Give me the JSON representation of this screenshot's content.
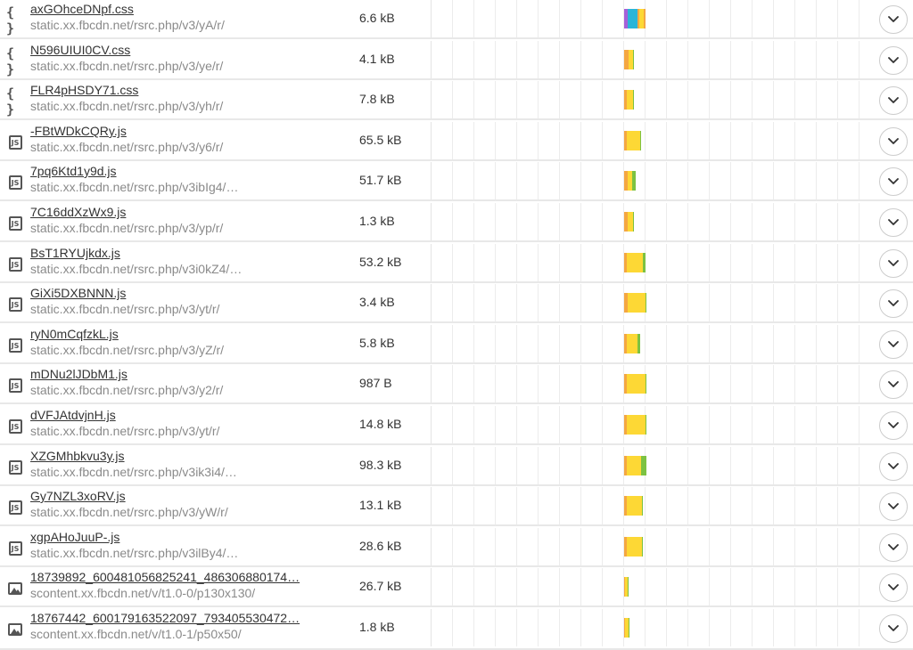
{
  "colors": {
    "blocking": "#f4a742",
    "connect": "#2bb5d8",
    "tls": "#a560d8",
    "waiting": "#fdd835",
    "receiving": "#7cc242",
    "expand_border": "#cccccc"
  },
  "requests": [
    {
      "type": "css",
      "icon": "css-braces-icon",
      "name": "axGOhceDNpf.css",
      "url": "static.xx.fbcdn.net/rsrc.php/v3/yA/r/",
      "size": "6.6 kB",
      "timing": [
        {
          "phase": "tls",
          "start": 0.6838,
          "width": 0.0039
        },
        {
          "phase": "connect",
          "start": 0.6877,
          "width": 0.0107
        },
        {
          "phase": "blocking",
          "start": 0.6984,
          "width": 0.002
        },
        {
          "phase": "waiting",
          "start": 0.7004,
          "width": 0.0049
        },
        {
          "phase": "blocking",
          "start": 0.7053,
          "width": 0.002
        }
      ]
    },
    {
      "type": "css",
      "icon": "css-braces-icon",
      "name": "N596UIUI0CV.css",
      "url": "static.xx.fbcdn.net/rsrc.php/v3/ye/r/",
      "size": "4.1 kB",
      "timing": [
        {
          "phase": "blocking",
          "start": 0.6838,
          "width": 0.0049
        },
        {
          "phase": "waiting",
          "start": 0.6887,
          "width": 0.0049
        },
        {
          "phase": "receiving",
          "start": 0.6936,
          "width": 0.001
        }
      ]
    },
    {
      "type": "css",
      "icon": "css-braces-icon",
      "name": "FLR4pHSDY71.css",
      "url": "static.xx.fbcdn.net/rsrc.php/v3/yh/r/",
      "size": "7.8 kB",
      "timing": [
        {
          "phase": "blocking",
          "start": 0.6838,
          "width": 0.0029
        },
        {
          "phase": "waiting",
          "start": 0.6867,
          "width": 0.0068
        },
        {
          "phase": "receiving",
          "start": 0.6935,
          "width": 0.001
        }
      ]
    },
    {
      "type": "js",
      "icon": "js-file-icon",
      "name": "-FBtWDkCQRy.js",
      "url": "static.xx.fbcdn.net/rsrc.php/v3/y6/r/",
      "size": "65.5 kB",
      "timing": [
        {
          "phase": "blocking",
          "start": 0.6838,
          "width": 0.0029
        },
        {
          "phase": "waiting",
          "start": 0.6867,
          "width": 0.0146
        },
        {
          "phase": "receiving",
          "start": 0.7013,
          "width": 0.001
        }
      ]
    },
    {
      "type": "js",
      "icon": "js-file-icon",
      "name": "7pq6Ktd1y9d.js",
      "url": "static.xx.fbcdn.net/rsrc.php/v3ibIg4/…",
      "size": "51.7 kB",
      "timing": [
        {
          "phase": "blocking",
          "start": 0.6838,
          "width": 0.0039
        },
        {
          "phase": "waiting",
          "start": 0.6877,
          "width": 0.0049
        },
        {
          "phase": "receiving",
          "start": 0.6926,
          "width": 0.0039
        }
      ]
    },
    {
      "type": "js",
      "icon": "js-file-icon",
      "name": "7C16ddXzWx9.js",
      "url": "static.xx.fbcdn.net/rsrc.php/v3/yp/r/",
      "size": "1.3 kB",
      "timing": [
        {
          "phase": "blocking",
          "start": 0.6838,
          "width": 0.0039
        },
        {
          "phase": "waiting",
          "start": 0.6877,
          "width": 0.0059
        },
        {
          "phase": "receiving",
          "start": 0.6936,
          "width": 0.001
        }
      ]
    },
    {
      "type": "js",
      "icon": "js-file-icon",
      "name": "BsT1RYUjkdx.js",
      "url": "static.xx.fbcdn.net/rsrc.php/v3i0kZ4/…",
      "size": "53.2 kB",
      "timing": [
        {
          "phase": "blocking",
          "start": 0.6838,
          "width": 0.0029
        },
        {
          "phase": "waiting",
          "start": 0.6867,
          "width": 0.0176
        },
        {
          "phase": "receiving",
          "start": 0.7043,
          "width": 0.0029
        }
      ]
    },
    {
      "type": "js",
      "icon": "js-file-icon",
      "name": "GiXi5DXBNNN.js",
      "url": "static.xx.fbcdn.net/rsrc.php/v3/yt/r/",
      "size": "3.4 kB",
      "timing": [
        {
          "phase": "blocking",
          "start": 0.6838,
          "width": 0.0039
        },
        {
          "phase": "waiting",
          "start": 0.6877,
          "width": 0.0195
        },
        {
          "phase": "receiving",
          "start": 0.7072,
          "width": 0.001
        }
      ]
    },
    {
      "type": "js",
      "icon": "js-file-icon",
      "name": "ryN0mCqfzkL.js",
      "url": "static.xx.fbcdn.net/rsrc.php/v3/yZ/r/",
      "size": "5.8 kB",
      "timing": [
        {
          "phase": "blocking",
          "start": 0.6838,
          "width": 0.0029
        },
        {
          "phase": "waiting",
          "start": 0.6867,
          "width": 0.0117
        },
        {
          "phase": "receiving",
          "start": 0.6984,
          "width": 0.0029
        }
      ]
    },
    {
      "type": "js",
      "icon": "js-file-icon",
      "name": "mDNu2lJDbM1.js",
      "url": "static.xx.fbcdn.net/rsrc.php/v3/y2/r/",
      "size": "987 B",
      "timing": [
        {
          "phase": "blocking",
          "start": 0.6838,
          "width": 0.0029
        },
        {
          "phase": "waiting",
          "start": 0.6867,
          "width": 0.0205
        },
        {
          "phase": "receiving",
          "start": 0.7072,
          "width": 0.001
        }
      ]
    },
    {
      "type": "js",
      "icon": "js-file-icon",
      "name": "dVFJAtdvjnH.js",
      "url": "static.xx.fbcdn.net/rsrc.php/v3/yt/r/",
      "size": "14.8 kB",
      "timing": [
        {
          "phase": "blocking",
          "start": 0.6838,
          "width": 0.0029
        },
        {
          "phase": "waiting",
          "start": 0.6867,
          "width": 0.0205
        },
        {
          "phase": "receiving",
          "start": 0.7072,
          "width": 0.001
        }
      ]
    },
    {
      "type": "js",
      "icon": "js-file-icon",
      "name": "XZGMhbkvu3y.js",
      "url": "static.xx.fbcdn.net/rsrc.php/v3ik3i4/…",
      "size": "98.3 kB",
      "timing": [
        {
          "phase": "blocking",
          "start": 0.6838,
          "width": 0.0029
        },
        {
          "phase": "waiting",
          "start": 0.6867,
          "width": 0.0156
        },
        {
          "phase": "receiving",
          "start": 0.7023,
          "width": 0.0059
        }
      ]
    },
    {
      "type": "js",
      "icon": "js-file-icon",
      "name": "Gy7NZL3xoRV.js",
      "url": "static.xx.fbcdn.net/rsrc.php/v3/yW/r/",
      "size": "13.1 kB",
      "timing": [
        {
          "phase": "blocking",
          "start": 0.6838,
          "width": 0.0029
        },
        {
          "phase": "waiting",
          "start": 0.6867,
          "width": 0.0166
        },
        {
          "phase": "receiving",
          "start": 0.7033,
          "width": 0.001
        }
      ]
    },
    {
      "type": "js",
      "icon": "js-file-icon",
      "name": "xgpAHoJuuP-.js",
      "url": "static.xx.fbcdn.net/rsrc.php/v3ilBy4/…",
      "size": "28.6 kB",
      "timing": [
        {
          "phase": "blocking",
          "start": 0.6838,
          "width": 0.0029
        },
        {
          "phase": "waiting",
          "start": 0.6867,
          "width": 0.0166
        },
        {
          "phase": "receiving",
          "start": 0.7033,
          "width": 0.001
        }
      ]
    },
    {
      "type": "image",
      "icon": "image-file-icon",
      "name": "18739892_600481056825241_486306880174…",
      "url": "scontent.xx.fbcdn.net/v/t1.0-0/p130x130/",
      "size": "26.7 kB",
      "timing": [
        {
          "phase": "blocking",
          "start": 0.6838,
          "width": 0.001
        },
        {
          "phase": "waiting",
          "start": 0.6848,
          "width": 0.0029
        },
        {
          "phase": "receiving",
          "start": 0.6877,
          "width": 0.001
        }
      ]
    },
    {
      "type": "image",
      "icon": "image-file-icon",
      "name": "18767442_600179163522097_793405530472…",
      "url": "scontent.xx.fbcdn.net/v/t1.0-1/p50x50/",
      "size": "1.8 kB",
      "timing": [
        {
          "phase": "blocking",
          "start": 0.6838,
          "width": 0.001
        },
        {
          "phase": "waiting",
          "start": 0.6848,
          "width": 0.0039
        },
        {
          "phase": "receiving",
          "start": 0.6887,
          "width": 0.001
        }
      ]
    }
  ]
}
